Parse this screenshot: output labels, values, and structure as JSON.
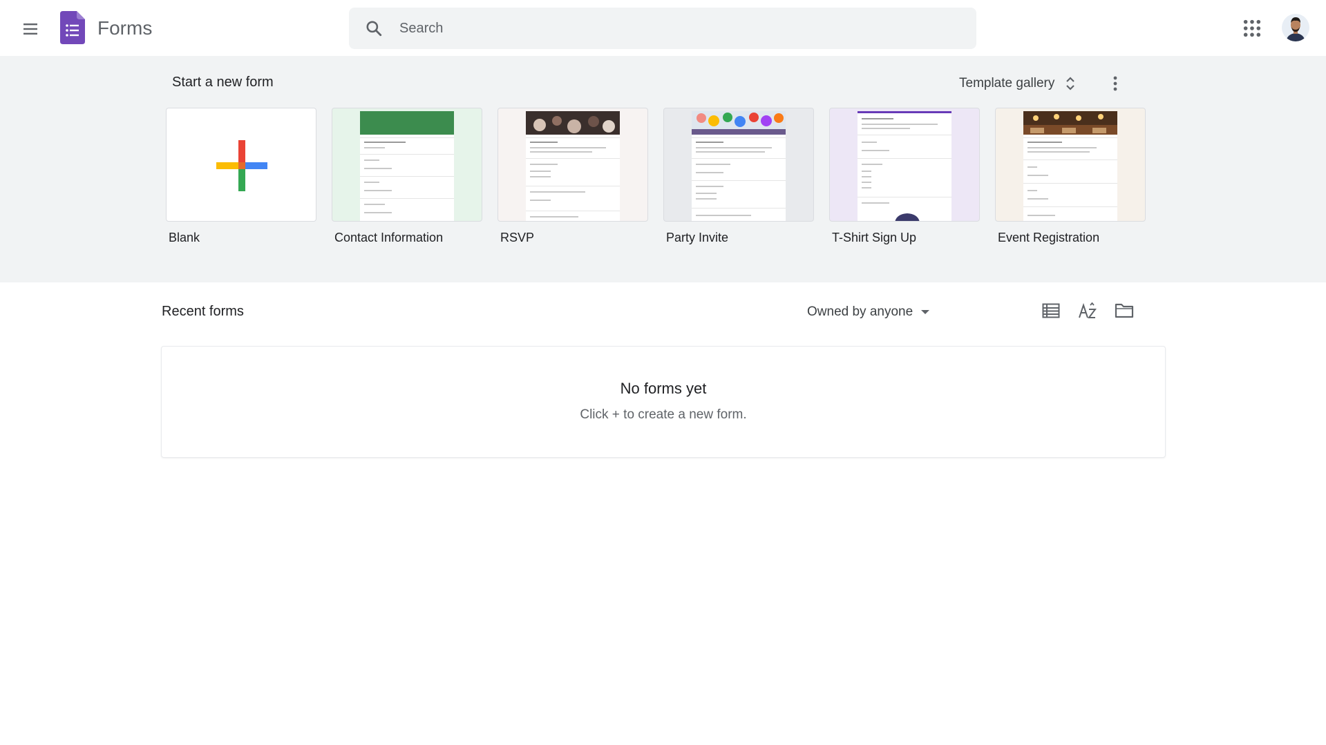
{
  "app": {
    "name": "Forms",
    "brand_color": "#7248b9"
  },
  "search": {
    "placeholder": "Search"
  },
  "start": {
    "title": "Start a new form",
    "template_gallery_label": "Template gallery",
    "templates": [
      {
        "label": "Blank"
      },
      {
        "label": "Contact Information"
      },
      {
        "label": "RSVP"
      },
      {
        "label": "Party Invite"
      },
      {
        "label": "T-Shirt Sign Up"
      },
      {
        "label": "Event Registration"
      }
    ]
  },
  "recent": {
    "title": "Recent forms",
    "owner_filter": "Owned by anyone",
    "empty_title": "No forms yet",
    "empty_subtitle": "Click + to create a new form."
  },
  "colors": {
    "section_bg": "#f1f3f4",
    "search_bg": "#f1f3f4",
    "contact_green": "#e6f4ea",
    "party_grey": "#e8eaed",
    "tshirt_purple": "#ede7f6",
    "event_beige": "#f6f1ea"
  },
  "icons": {
    "menu": "menu-icon",
    "search": "search-icon",
    "apps": "apps-grid-icon",
    "more": "more-vert-icon",
    "list_view": "list-view-icon",
    "sort": "sort-az-icon",
    "folder": "folder-icon",
    "template_gallery_toggle": "unfold-icon"
  }
}
